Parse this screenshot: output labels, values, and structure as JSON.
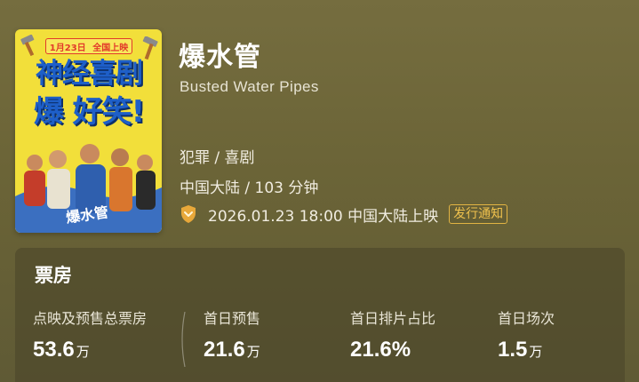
{
  "poster": {
    "release_date": "1月23日",
    "release_tag": "全国上映",
    "headline_line1": "神经喜剧",
    "headline_line2": "爆 好笑!",
    "colors": {
      "background": "#f2df3a",
      "headline": "#1e5fc8",
      "badge": "#e23a2a"
    }
  },
  "movie": {
    "title_cn": "爆水管",
    "title_en": "Busted Water Pipes",
    "genre": "犯罪 / 喜剧",
    "region_duration": "中国大陆 / 103 分钟",
    "release": "2026.01.23 18:00 中国大陆上映",
    "notice_button": "发行通知",
    "release_icon": "shield-icon"
  },
  "box_office": {
    "title": "票房",
    "stats": [
      {
        "label": "点映及预售总票房",
        "value": "53.6",
        "unit": "万"
      },
      {
        "label": "首日预售",
        "value": "21.6",
        "unit": "万"
      },
      {
        "label": "首日排片占比",
        "value": "21.6%",
        "unit": ""
      },
      {
        "label": "首日场次",
        "value": "1.5",
        "unit": "万"
      }
    ]
  },
  "colors": {
    "page_background": "#6a6434",
    "accent": "#f0c24d",
    "shield": "#e8a83a"
  }
}
